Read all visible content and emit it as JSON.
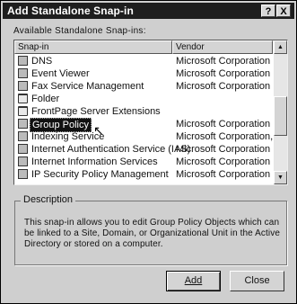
{
  "window": {
    "title": "Add Standalone Snap-in",
    "help_glyph": "?",
    "close_glyph": "X"
  },
  "available_label": "Available Standalone Snap-ins:",
  "columns": {
    "snapin": "Snap-in",
    "vendor": "Vendor"
  },
  "rows": [
    {
      "name": "DNS",
      "vendor": "Microsoft Corporation",
      "icon": "dns-icon"
    },
    {
      "name": "Event Viewer",
      "vendor": "Microsoft Corporation",
      "icon": "event-viewer-icon"
    },
    {
      "name": "Fax Service Management",
      "vendor": "Microsoft Corporation",
      "icon": "fax-icon"
    },
    {
      "name": "Folder",
      "vendor": "",
      "icon": "folder-icon"
    },
    {
      "name": "FrontPage Server Extensions",
      "vendor": "",
      "icon": "frontpage-icon"
    },
    {
      "name": "Group Policy",
      "vendor": "Microsoft Corporation",
      "icon": "group-policy-icon",
      "selected": true
    },
    {
      "name": "Indexing Service",
      "vendor": "Microsoft Corporation, In...",
      "icon": "indexing-icon"
    },
    {
      "name": "Internet Authentication Service (IAS)",
      "vendor": "Microsoft Corporation",
      "icon": "ias-icon"
    },
    {
      "name": "Internet Information Services",
      "vendor": "Microsoft Corporation",
      "icon": "iis-icon"
    },
    {
      "name": "IP Security Policy Management",
      "vendor": "Microsoft Corporation",
      "icon": "ipsec-icon"
    }
  ],
  "description": {
    "label": "Description",
    "text": "This snap-in allows you to edit Group Policy Objects which can be linked to a Site, Domain, or Organizational Unit in the Active Directory or stored on a computer."
  },
  "buttons": {
    "add": "Add",
    "close": "Close"
  }
}
